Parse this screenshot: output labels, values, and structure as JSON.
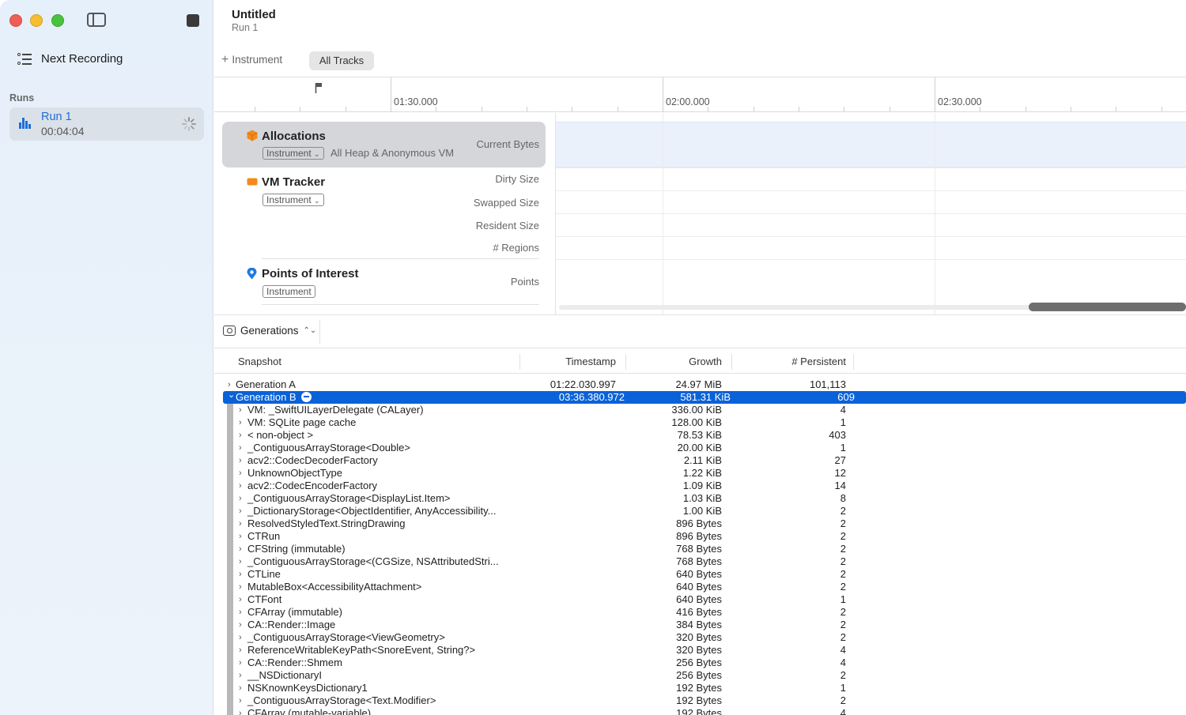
{
  "sidebar": {
    "next_recording_label": "Next Recording",
    "runs_heading": "Runs",
    "runs": [
      {
        "name": "Run 1",
        "duration": "00:04:04"
      }
    ]
  },
  "header": {
    "title": "Untitled",
    "subtitle": "Run 1",
    "add_instrument_label": "Instrument",
    "all_tracks_label": "All Tracks"
  },
  "ruler": {
    "ticks": [
      "01:30.000",
      "02:00.000",
      "02:30.000"
    ]
  },
  "tracks": [
    {
      "name": "Allocations",
      "icon": "cube-icon",
      "icon_color": "#f28a1c",
      "pill": "Instrument",
      "subtitle": "All Heap & Anonymous VM",
      "metrics": [
        "Current Bytes"
      ]
    },
    {
      "name": "VM Tracker",
      "icon": "vm-icon",
      "icon_color": "#f28a1c",
      "pill": "Instrument",
      "metrics": [
        "Dirty Size",
        "Swapped Size",
        "Resident Size",
        "# Regions"
      ]
    },
    {
      "name": "Points of Interest",
      "icon": "pin-icon",
      "icon_color": "#1f7ae0",
      "pill": "Instrument",
      "metrics": [
        "Points"
      ]
    }
  ],
  "detail": {
    "mode_label": "Generations",
    "columns": {
      "snapshot": "Snapshot",
      "timestamp": "Timestamp",
      "growth": "Growth",
      "persistent": "# Persistent"
    },
    "rows": [
      {
        "level": 0,
        "name": "Generation A",
        "timestamp": "01:22.030.997",
        "growth": "24.97 MiB",
        "persistent": "101,113",
        "selected": false,
        "expanded": false
      },
      {
        "level": 0,
        "name": "Generation B",
        "timestamp": "03:36.380.972",
        "growth": "581.31 KiB",
        "persistent": "609",
        "selected": true,
        "expanded": true
      },
      {
        "level": 1,
        "name": "VM: _SwiftUILayerDelegate (CALayer)",
        "growth": "336.00 KiB",
        "persistent": "4"
      },
      {
        "level": 1,
        "name": "VM: SQLite page cache",
        "growth": "128.00 KiB",
        "persistent": "1"
      },
      {
        "level": 1,
        "name": "< non-object >",
        "growth": "78.53 KiB",
        "persistent": "403"
      },
      {
        "level": 1,
        "name": "_ContiguousArrayStorage<Double>",
        "growth": "20.00 KiB",
        "persistent": "1"
      },
      {
        "level": 1,
        "name": "acv2::CodecDecoderFactory",
        "growth": "2.11 KiB",
        "persistent": "27"
      },
      {
        "level": 1,
        "name": "UnknownObjectType",
        "growth": "1.22 KiB",
        "persistent": "12"
      },
      {
        "level": 1,
        "name": "acv2::CodecEncoderFactory",
        "growth": "1.09 KiB",
        "persistent": "14"
      },
      {
        "level": 1,
        "name": "_ContiguousArrayStorage<DisplayList.Item>",
        "growth": "1.03 KiB",
        "persistent": "8"
      },
      {
        "level": 1,
        "name": "_DictionaryStorage<ObjectIdentifier, AnyAccessibility...",
        "growth": "1.00 KiB",
        "persistent": "2"
      },
      {
        "level": 1,
        "name": "ResolvedStyledText.StringDrawing",
        "growth": "896 Bytes",
        "persistent": "2"
      },
      {
        "level": 1,
        "name": "CTRun",
        "growth": "896 Bytes",
        "persistent": "2"
      },
      {
        "level": 1,
        "name": "CFString (immutable)",
        "growth": "768 Bytes",
        "persistent": "2"
      },
      {
        "level": 1,
        "name": "_ContiguousArrayStorage<(CGSize, NSAttributedStri...",
        "growth": "768 Bytes",
        "persistent": "2"
      },
      {
        "level": 1,
        "name": "CTLine",
        "growth": "640 Bytes",
        "persistent": "2"
      },
      {
        "level": 1,
        "name": "MutableBox<AccessibilityAttachment>",
        "growth": "640 Bytes",
        "persistent": "2"
      },
      {
        "level": 1,
        "name": "CTFont",
        "growth": "640 Bytes",
        "persistent": "1"
      },
      {
        "level": 1,
        "name": "CFArray (immutable)",
        "growth": "416 Bytes",
        "persistent": "2"
      },
      {
        "level": 1,
        "name": "CA::Render::Image",
        "growth": "384 Bytes",
        "persistent": "2"
      },
      {
        "level": 1,
        "name": "_ContiguousArrayStorage<ViewGeometry>",
        "growth": "320 Bytes",
        "persistent": "2"
      },
      {
        "level": 1,
        "name": "ReferenceWritableKeyPath<SnoreEvent, String?>",
        "growth": "320 Bytes",
        "persistent": "4"
      },
      {
        "level": 1,
        "name": "CA::Render::Shmem",
        "growth": "256 Bytes",
        "persistent": "4"
      },
      {
        "level": 1,
        "name": "__NSDictionaryI",
        "growth": "256 Bytes",
        "persistent": "2"
      },
      {
        "level": 1,
        "name": "NSKnownKeysDictionary1",
        "growth": "192 Bytes",
        "persistent": "1"
      },
      {
        "level": 1,
        "name": "_ContiguousArrayStorage<Text.Modifier>",
        "growth": "192 Bytes",
        "persistent": "2"
      },
      {
        "level": 1,
        "name": "CFArray (mutable-variable)",
        "growth": "192 Bytes",
        "persistent": "4"
      }
    ]
  },
  "colors": {
    "accent": "#0a62d8",
    "link_blue": "#1f6fd6",
    "close": "#ee5d57",
    "minimize": "#f4be2f",
    "maximize": "#4ac23e"
  }
}
